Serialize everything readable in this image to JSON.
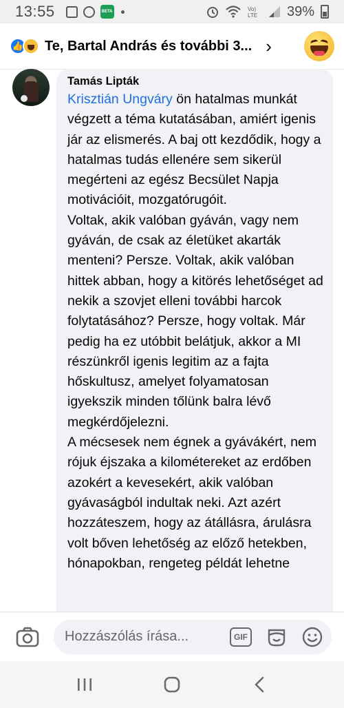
{
  "status_bar": {
    "time": "13:55",
    "battery_percent": "39%",
    "app_icon_label": "BETA",
    "icons": [
      "gallery-icon",
      "messenger-icon",
      "app-icon",
      "alarm-icon",
      "wifi-icon",
      "volte-icon",
      "signal-icon",
      "battery-icon"
    ]
  },
  "header": {
    "title": "Te, Bartal András és további 3...",
    "reaction_icons": [
      "like-reaction-icon",
      "haha-reaction-icon"
    ],
    "like_glyph": "👍",
    "chevron_glyph": "›"
  },
  "comment": {
    "author": "Tamás Lipták",
    "mention": "Krisztián Ungváry",
    "text_after_mention": " ön hatalmas munkát végzett a téma kutatásában, amiért igenis jár az elismerés. A baj ott kezdődik, hogy a hatalmas tudás ellenére sem sikerül megérteni az egész Becsület Napja motivációit, mozgatórugóit.",
    "paragraphs": [
      "Voltak, akik valóban gyáván, vagy nem gyáván, de csak az életüket akarták menteni? Persze. Voltak, akik valóban hittek abban, hogy a kitörés lehetőséget ad nekik a szovjet elleni további harcok folytatásához? Persze, hogy voltak. Már pedig ha ez utóbbit belátjuk, akkor a MI részünkről igenis legitim az a fajta hőskultusz, amelyet folyamatosan igyekszik minden tőlünk balra lévő megkérdőjelezni.",
      "A mécsesek nem égnek a gyávákért, nem rójuk éjszaka a kilométereket az erdőben azokért a kevesekért, akik valóban gyávaságból indultak neki. Azt azért hozzáteszem, hogy az átállásra, árulásra volt bőven lehetőség az előző hetekben, hónapokban, rengeteg példát lehetne"
    ]
  },
  "composer": {
    "placeholder": "Hozzászólás írása...",
    "gif_label": "GIF"
  },
  "navbar": {
    "recents_glyph": "|||",
    "back_glyph": "‹"
  },
  "colors": {
    "mention": "#216fdb",
    "bubble_bg": "#f0f2f5",
    "like_blue": "#1877f2"
  }
}
